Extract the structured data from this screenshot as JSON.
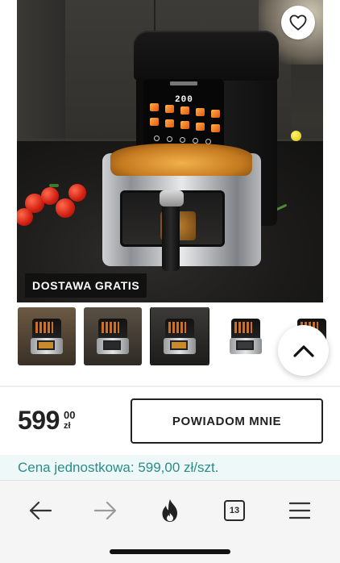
{
  "product": {
    "badge": "DOSTAWA GRATIS",
    "panel_temperature": "200",
    "thumbnail_count": 5,
    "selected_thumbnail_index": 2
  },
  "price": {
    "main": "599",
    "cents": "00",
    "currency": "zł"
  },
  "buttons": {
    "notify_label": "POWIADOM MNIE"
  },
  "unit_price": {
    "text": "Cena jednostkowa: 599,00 zł/szt."
  },
  "browser_nav": {
    "tabs_count": "13",
    "items": [
      {
        "name": "back",
        "icon": "arrow-left-icon",
        "enabled": true
      },
      {
        "name": "forward",
        "icon": "arrow-right-icon",
        "enabled": false
      },
      {
        "name": "fire",
        "icon": "flame-icon",
        "enabled": true
      },
      {
        "name": "tabs",
        "icon": "tabs-icon",
        "enabled": true
      },
      {
        "name": "menu",
        "icon": "menu-icon",
        "enabled": true
      }
    ]
  },
  "colors": {
    "text_dark": "#222222",
    "unit_price_text": "#2b8c88",
    "unit_price_bg": "#eef8f8",
    "badge_bg": "#111111",
    "nav_bg": "#f5f5f5"
  }
}
